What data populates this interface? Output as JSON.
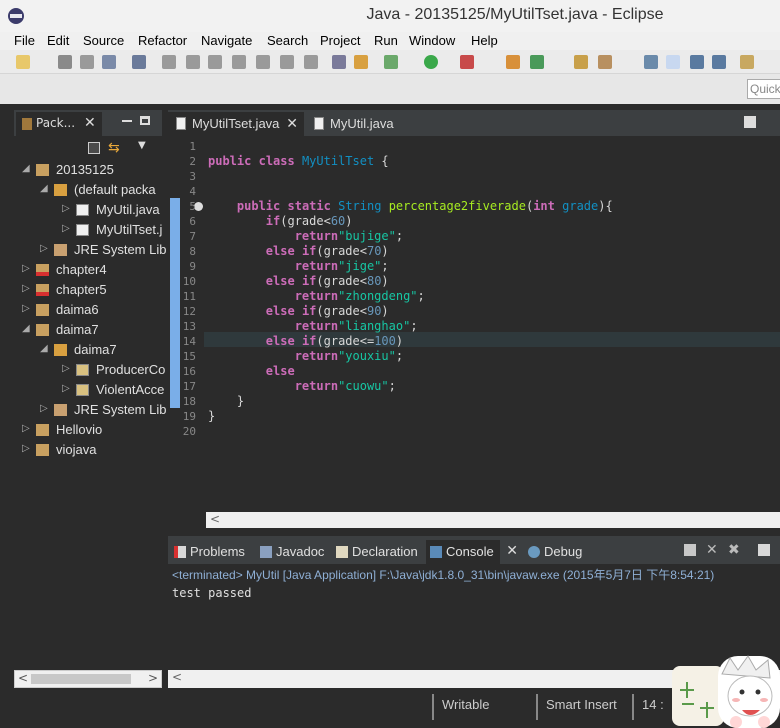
{
  "window": {
    "title": "Java - 20135125/MyUtilTset.java - Eclipse"
  },
  "menu": [
    "File",
    "Edit",
    "Source",
    "Refactor",
    "Navigate",
    "Search",
    "Project",
    "Run",
    "Window",
    "Help"
  ],
  "quick_access": {
    "placeholder": "Quick"
  },
  "package_explorer": {
    "tab_label": "Pack...",
    "tree": [
      {
        "label": "20135125",
        "icon": "project-icon"
      },
      {
        "label": "(default packa",
        "icon": "package-icon"
      },
      {
        "label": "MyUtil.java",
        "icon": "java-file-icon"
      },
      {
        "label": "MyUtilTset.j",
        "icon": "java-file-icon"
      },
      {
        "label": "JRE System Lib",
        "icon": "library-icon"
      },
      {
        "label": "chapter4",
        "icon": "project-error-icon"
      },
      {
        "label": "chapter5",
        "icon": "project-error-icon"
      },
      {
        "label": "daima6",
        "icon": "project-icon"
      },
      {
        "label": "daima7",
        "icon": "project-icon"
      },
      {
        "label": "daima7",
        "icon": "package-icon"
      },
      {
        "label": "ProducerCo",
        "icon": "java-file-icon"
      },
      {
        "label": "ViolentAcce",
        "icon": "java-file-icon"
      },
      {
        "label": "JRE System Lib",
        "icon": "library-icon"
      },
      {
        "label": "Hellovio",
        "icon": "project-icon"
      },
      {
        "label": "viojava",
        "icon": "project-icon"
      }
    ]
  },
  "editor": {
    "tabs": [
      {
        "label": "MyUtilTset.java",
        "active": true
      },
      {
        "label": "MyUtil.java",
        "active": false
      }
    ],
    "line_numbers": [
      "1",
      "2",
      "3",
      "4",
      "5",
      "6",
      "7",
      "8",
      "9",
      "10",
      "11",
      "12",
      "13",
      "14",
      "15",
      "16",
      "17",
      "18",
      "19",
      "20"
    ]
  },
  "bottom_panel": {
    "tabs": [
      "Problems",
      "Javadoc",
      "Declaration",
      "Console",
      "Debug"
    ],
    "console_header": "<terminated> MyUtil [Java Application] F:\\Java\\jdk1.8.0_31\\bin\\javaw.exe (2015年5月7日 下午8:54:21)",
    "console_output": "test passed"
  },
  "status_bar": {
    "writable": "Writable",
    "insert_mode": "Smart Insert",
    "position": "14 :"
  },
  "colors": {
    "keyword": "#cc6cb8",
    "class": "#1290c3",
    "method": "#a7ec21",
    "string": "#17c6a3",
    "number": "#6897bb",
    "background": "#2b2b2b"
  }
}
